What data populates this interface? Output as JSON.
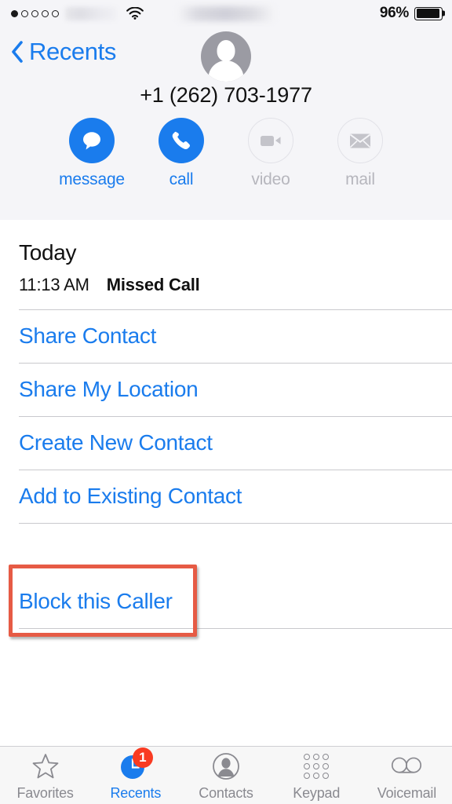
{
  "status_bar": {
    "signal_dots_total": 5,
    "signal_dots_filled": 1,
    "carrier": "",
    "wifi_icon": "wifi-icon",
    "time": "",
    "battery_percent": "96%",
    "battery_level": 96
  },
  "header": {
    "back_label": "Recents",
    "back_icon": "chevron-left-icon",
    "avatar_icon": "person-placeholder-avatar",
    "phone_number": "+1 (262) 703-1977",
    "actions": [
      {
        "label": "message",
        "icon": "message-bubble-icon",
        "enabled": true
      },
      {
        "label": "call",
        "icon": "phone-handset-icon",
        "enabled": true
      },
      {
        "label": "video",
        "icon": "video-camera-icon",
        "enabled": false
      },
      {
        "label": "mail",
        "icon": "envelope-icon",
        "enabled": false
      }
    ]
  },
  "call_history": {
    "section_title": "Today",
    "entries": [
      {
        "time": "11:13 AM",
        "type": "Missed Call"
      }
    ]
  },
  "action_items": [
    {
      "label": "Share Contact"
    },
    {
      "label": "Share My Location"
    },
    {
      "label": "Create New Contact"
    },
    {
      "label": "Add to Existing Contact"
    }
  ],
  "block_section": {
    "label": "Block this Caller",
    "highlighted": true,
    "highlight_color": "#e65b45"
  },
  "tab_bar": {
    "tabs": [
      {
        "label": "Favorites",
        "icon": "star-icon",
        "active": false,
        "badge": null
      },
      {
        "label": "Recents",
        "icon": "clock-icon",
        "active": true,
        "badge": "1"
      },
      {
        "label": "Contacts",
        "icon": "person-icon",
        "active": false,
        "badge": null
      },
      {
        "label": "Keypad",
        "icon": "keypad-grid-icon",
        "active": false,
        "badge": null
      },
      {
        "label": "Voicemail",
        "icon": "voicemail-icon",
        "active": false,
        "badge": null
      }
    ]
  },
  "colors": {
    "accent_blue": "#1a7ced",
    "badge_red": "#f93b22",
    "annotation_red": "#e65b45",
    "header_bg": "#f5f5f8",
    "disabled_gray": "#b6b6bd"
  }
}
